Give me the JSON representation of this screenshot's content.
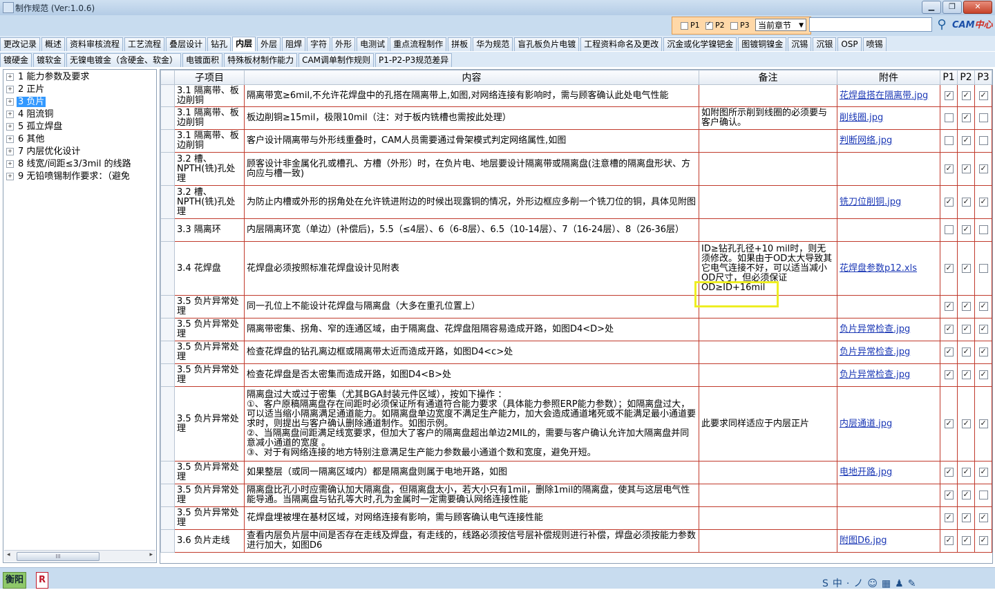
{
  "window": {
    "title": "制作规范 (Ver:1.0.6)",
    "minimize": "▁",
    "restore": "❐",
    "close": "✕"
  },
  "filter": {
    "p1": "P1",
    "p2": "P2",
    "p3": "P3",
    "p1_checked": false,
    "p2_checked": true,
    "p3_checked": false,
    "chapter": "当前章节",
    "search_placeholder": ""
  },
  "logo": {
    "text": "CAM",
    "accent": "中心"
  },
  "tabs_row1": [
    "更改记录",
    "概述",
    "资料审核流程",
    "工艺流程",
    "叠层设计",
    "钻孔",
    "内层",
    "外层",
    "阻焊",
    "字符",
    "外形",
    "电测试",
    "重点流程制作",
    "拼板",
    "华为规范",
    "盲孔板负片电镀",
    "工程资料命名及更改",
    "沉金或化学镍钯金",
    "图镀铜镍金",
    "沉锡",
    "沉银",
    "OSP",
    "喷锡"
  ],
  "tabs_row2": [
    "镀硬金",
    "镀软金",
    "无镍电镀金（含硬金、软金）",
    "电镀面积",
    "特殊板材制作能力",
    "CAM调单制作规则",
    "P1-P2-P3规范差异"
  ],
  "active_tab": "内层",
  "tree": [
    {
      "label": "1  能力参数及要求",
      "selected": false
    },
    {
      "label": "2  正片",
      "selected": false
    },
    {
      "label": "3  负片",
      "selected": true
    },
    {
      "label": "4  阻流铜",
      "selected": false
    },
    {
      "label": "5  孤立焊盘",
      "selected": false
    },
    {
      "label": "6  其他",
      "selected": false
    },
    {
      "label": "7  内层优化设计",
      "selected": false
    },
    {
      "label": "8  线宽/间距≤3/3mil 的线路",
      "selected": false
    },
    {
      "label": "9  无铅喷锡制作要求：（避免",
      "selected": false
    }
  ],
  "grid": {
    "headers": {
      "item": "子项目",
      "content": "内容",
      "note": "备注",
      "attach": "附件",
      "p1": "P1",
      "p2": "P2",
      "p3": "P3"
    },
    "rows": [
      {
        "item": "3.1 隔离带、板边削铜",
        "content": "隔离带宽≥6mil,不允许花焊盘中的孔搭在隔离带上,如图,对网络连接有影响时，需与顾客确认此处电气性能",
        "note": "",
        "attach": "花焊盘搭在隔离带.jpg",
        "p1": true,
        "p2": true,
        "p3": true
      },
      {
        "item": "3.1 隔离带、板边削铜",
        "content": "板边削铜≥15mil，极限10mil（注：对于板内铣槽也需按此处理）",
        "note": "如附图所示削到线圈的必须要与客户确认。",
        "attach": "削线圈.jpg",
        "p1": false,
        "p2": true,
        "p3": false
      },
      {
        "item": "3.1 隔离带、板边削铜",
        "content": "客户设计隔离带与外形线重叠时，CAM人员需要通过骨架模式判定网络属性,如图",
        "note": "",
        "attach": "判断网络.jpg",
        "p1": false,
        "p2": true,
        "p3": false
      },
      {
        "item": "3.2 槽、NPTH(铣)孔处理",
        "content": "顾客设计非金属化孔或槽孔、方槽（外形）时，在负片电、地层要设计隔离带或隔离盘(注意槽的隔离盘形状、方向应与槽一致)",
        "note": "",
        "attach": "",
        "p1": true,
        "p2": true,
        "p3": true
      },
      {
        "item": "3.2 槽、NPTH(铣)孔处理",
        "content": "为防止内槽或外形的拐角处在允许铣进附边的时候出现露铜的情况，外形边框应多削一个铣刀位的铜，具体见附图",
        "note": "",
        "attach": "铣刀位削铜.jpg",
        "p1": true,
        "p2": true,
        "p3": true
      },
      {
        "item": "3.3 隔离环",
        "content": "内层隔离环宽（单边）(补偿后)，5.5（≤4层）、6（6-8层）、6.5（10-14层）、7（16-24层）、8（26-36层）",
        "note": "",
        "attach": "",
        "p1": false,
        "p2": true,
        "p3": false
      },
      {
        "item": "3.4 花焊盘",
        "content": "花焊盘必须按照标准花焊盘设计见附表",
        "note": "ID≥钻孔孔径+10 mil时，则无须修改。如果由于OD太大导致其它电气连接不好，可以适当减小OD尺寸，但必须保证OD≥ID+16mil",
        "attach": "花焊盘参数p12.xls",
        "p1": true,
        "p2": true,
        "p3": false
      },
      {
        "item": "3.5 负片异常处理",
        "content": "同一孔位上不能设计花焊盘与隔离盘（大多在重孔位置上）",
        "note": "",
        "attach": "",
        "p1": true,
        "p2": true,
        "p3": true
      },
      {
        "item": "3.5 负片异常处理",
        "content": "隔离带密集、拐角、窄的连通区域，由于隔离盘、花焊盘阻隔容易造成开路，如图D4<D>处",
        "note": "",
        "attach": "负片异常检查.jpg",
        "p1": true,
        "p2": true,
        "p3": true
      },
      {
        "item": "3.5 负片异常处理",
        "content": "检查花焊盘的钻孔离边框或隔离带太近而造成开路，如图D4<c>处",
        "note": "",
        "attach": "负片异常检查.jpg",
        "p1": true,
        "p2": true,
        "p3": true
      },
      {
        "item": "3.5 负片异常处理",
        "content": "检查花焊盘是否太密集而造成开路，如图D4<B>处",
        "note": "",
        "attach": "负片异常检查.jpg",
        "p1": true,
        "p2": true,
        "p3": true
      },
      {
        "item": "3.5 负片异常处理",
        "content": "隔离盘过大或过于密集（尤其BGA封装元件区域），按如下操作 ：\n①、客户原稿隔离盘存在间距时必须保证所有通道符合能力要求（具体能力参照ERP能力参数）；如隔离盘过大，可以适当缩小隔离满足通道能力。如隔离盘单边宽度不满足生产能力，加大会造成通道堵死或不能满足最小通道要求时，则提出与客户确认删除通道制作。如图示例。\n②、当隔离盘间距满足线宽要求，但加大了客户的隔离盘超出单边2MIL的，需要与客户确认允许加大隔离盘并同意减小通道的宽度 。\n③、对于有网络连接的地方特别注意满足生产能力参数最小通道个数和宽度，避免开短。",
        "note": "此要求同样适应于内层正片",
        "attach": "内层通道.jpg",
        "p1": true,
        "p2": true,
        "p3": true
      },
      {
        "item": "3.5 负片异常处理",
        "content": "如果整层（或同一隔离区域内）都是隔离盘则属于电地开路，如图",
        "note": "",
        "attach": "电地开路.jpg",
        "p1": true,
        "p2": true,
        "p3": true
      },
      {
        "item": "3.5 负片异常处理",
        "content": "隔离盘比孔小时应需确认加大隔离盘，但隔离盘太小，若大小只有1mil，删除1mil的隔离盘，使其与这层电气性能导通。当隔离盘与钻孔等大时,孔为金属时一定需要确认网络连接性能",
        "note": "",
        "attach": "",
        "p1": true,
        "p2": true,
        "p3": false
      },
      {
        "item": "3.5 负片异常处理",
        "content": "花焊盘埋被埋在基材区域，对网络连接有影响，需与顾客确认电气连接性能",
        "note": "",
        "attach": "",
        "p1": true,
        "p2": true,
        "p3": true
      },
      {
        "item": "3.6 负片走线",
        "content": "查看内层负片层中间是否存在走线及焊盘，有走线的，线路必须按信号层补偿规则进行补偿，焊盘必须按能力参数进行加大，如图D6",
        "note": "",
        "attach": "附图D6.jpg",
        "p1": true,
        "p2": true,
        "p3": true
      }
    ]
  },
  "statusbar": {
    "user": "衡阳",
    "badge": "R",
    "ime": "S中·ノ☺▦♟✎"
  },
  "colors": {
    "accent": "#3399ff",
    "grid_border": "#c0392b",
    "highlight": "#eeee22",
    "link": "#1a37b5"
  }
}
